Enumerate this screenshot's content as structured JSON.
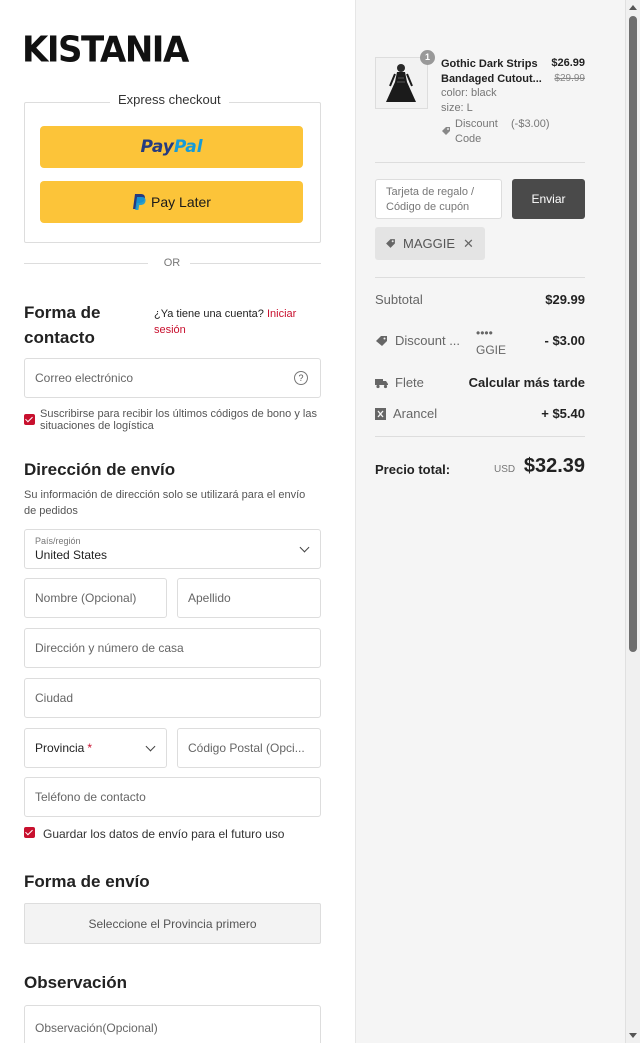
{
  "brand": {
    "logo_text": "KISTANIA"
  },
  "express": {
    "title": "Express checkout",
    "paypal_pay": "Pay",
    "paypal_pal": "Pal",
    "pay_later_label": "Pay Later",
    "or_text": "OR"
  },
  "contact": {
    "heading": "Forma de contacto",
    "account_question": "¿Ya tiene una cuenta?",
    "login_link": "Iniciar sesión",
    "email_placeholder": "Correo electrónico",
    "subscribe_label": "Suscribirse para recibir los últimos códigos de bono y las situaciones de logística",
    "subscribe_checked": true
  },
  "shipping_address": {
    "heading": "Dirección de envío",
    "note": "Su información de dirección solo se utilizará para el envío de pedidos",
    "country_label": "País/región",
    "country_value": "United States",
    "first_name_placeholder": "Nombre (Opcional)",
    "last_name_placeholder": "Apellido",
    "address_placeholder": "Dirección y número de casa",
    "city_placeholder": "Ciudad",
    "province_label": "Provincia",
    "required_mark": "*",
    "postal_placeholder": "Código Postal (Opci...",
    "phone_placeholder": "Teléfono de contacto",
    "save_label": "Guardar los datos de envío para el futuro uso",
    "save_checked": true
  },
  "shipping_method": {
    "heading": "Forma de envío",
    "select_province_first": "Seleccione el Provincia primero"
  },
  "notes": {
    "heading": "Observación",
    "placeholder": "Observación(Opcional)"
  },
  "cart": {
    "item": {
      "quantity": "1",
      "name": "Gothic Dark Strips Bandaged Cutout...",
      "price": "$26.99",
      "original_price": "$29.99",
      "color": "color: black",
      "size": "size: L",
      "discount_label": "Discount Code",
      "discount_value": "(-$3.00)"
    },
    "gift_placeholder": "Tarjeta de regalo / Código de cupón",
    "apply_label": "Enviar",
    "applied_coupon": "MAGGIE"
  },
  "summary": {
    "subtotal_label": "Subtotal",
    "subtotal_value": "$29.99",
    "discount_label": "Discount ...",
    "discount_code_masked": "•••• GGIE",
    "discount_value": "- $3.00",
    "shipping_label": "Flete",
    "shipping_value": "Calcular más tarde",
    "duty_label": "Arancel",
    "duty_value": "+ $5.40",
    "total_label": "Precio total:",
    "total_currency": "USD",
    "total_value": "$32.39"
  },
  "colors": {
    "paypal_yellow": "#fcc439",
    "paypal_dark_blue": "#253b80",
    "paypal_light_blue": "#179bd7",
    "accent_red": "#c8102e",
    "apply_button": "#4a4a4a",
    "summary_bg": "#f5f5f5"
  }
}
